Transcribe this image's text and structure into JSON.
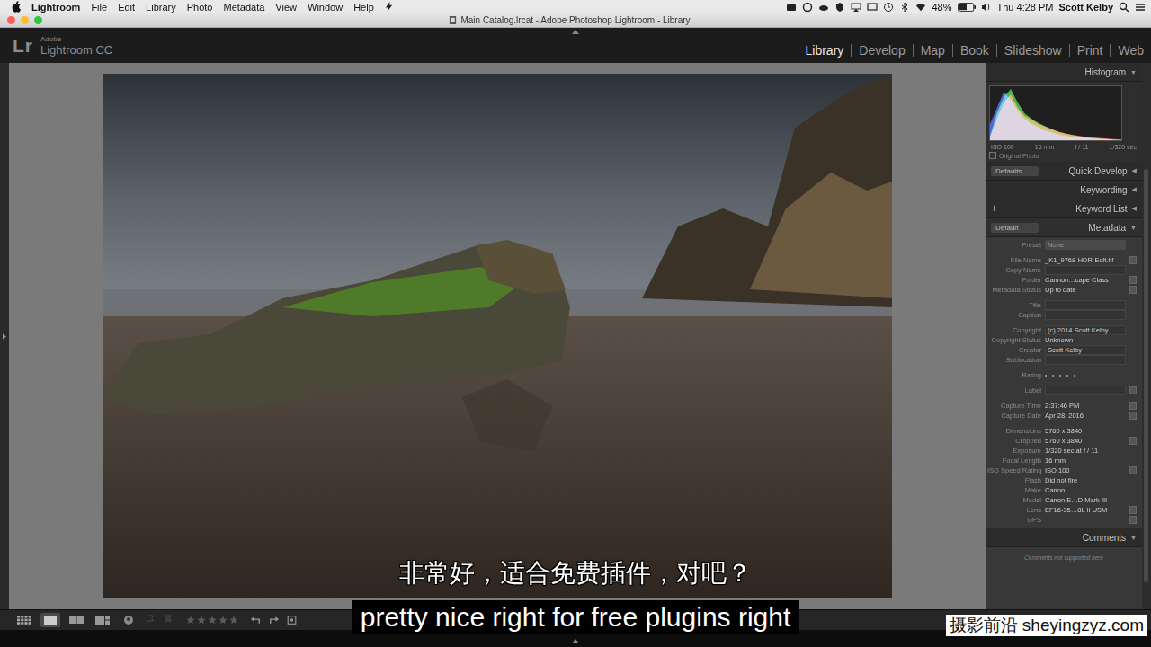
{
  "menubar": {
    "app": "Lightroom",
    "items": [
      "File",
      "Edit",
      "Library",
      "Photo",
      "Metadata",
      "View",
      "Window",
      "Help"
    ],
    "battery": "48%",
    "clock": "Thu 4:28 PM",
    "user": "Scott Kelby"
  },
  "window": {
    "title": "Main Catalog.lrcat - Adobe Photoshop Lightroom - Library"
  },
  "identity": {
    "logo": "Lr",
    "maker": "Adobe",
    "product": "Lightroom CC"
  },
  "modules": [
    {
      "label": "Library",
      "selected": true
    },
    {
      "label": "Develop",
      "selected": false
    },
    {
      "label": "Map",
      "selected": false
    },
    {
      "label": "Book",
      "selected": false
    },
    {
      "label": "Slideshow",
      "selected": false
    },
    {
      "label": "Print",
      "selected": false
    },
    {
      "label": "Web",
      "selected": false
    }
  ],
  "histogram": {
    "title": "Histogram",
    "toggle": "▼",
    "series": [
      {
        "color": "#d83a3a",
        "values": [
          5,
          40,
          70,
          85,
          60,
          45,
          38,
          30,
          25,
          20,
          16,
          12,
          10,
          8,
          6,
          5,
          4,
          3,
          2,
          1
        ]
      },
      {
        "color": "#3cb83c",
        "values": [
          8,
          50,
          80,
          95,
          70,
          50,
          40,
          32,
          26,
          20,
          15,
          12,
          9,
          7,
          5,
          4,
          3,
          2,
          1,
          1
        ]
      },
      {
        "color": "#3c5ce0",
        "values": [
          30,
          60,
          90,
          75,
          55,
          40,
          30,
          24,
          18,
          14,
          10,
          8,
          6,
          5,
          4,
          3,
          2,
          2,
          1,
          1
        ]
      }
    ],
    "info": [
      "ISO 100",
      "16 mm",
      "f / 11",
      "1/320 sec"
    ],
    "original_photo": {
      "label": "Original Photo",
      "checked": false
    }
  },
  "sections": [
    {
      "title": "Quick Develop",
      "toggle": "◀",
      "expanded": false,
      "kind": "preset",
      "preset": "Defaults"
    },
    {
      "title": "Keywording",
      "toggle": "◀",
      "expanded": false,
      "kind": "plain"
    },
    {
      "title": "Keyword List",
      "toggle": "◀",
      "expanded": false,
      "kind": "plus",
      "plus": "+"
    },
    {
      "title": "Metadata",
      "toggle": "▼",
      "expanded": true,
      "kind": "preset",
      "preset": "Default"
    }
  ],
  "metadata": {
    "preset_label": "Preset",
    "preset_value": "None",
    "groups": [
      [
        {
          "label": "File Name",
          "value": "_K1_9768-HDR-Edit.tif",
          "kind": "text",
          "button": true
        },
        {
          "label": "Copy Name",
          "value": "",
          "kind": "field",
          "button": false
        },
        {
          "label": "Folder",
          "value": "Cannon…cape Class",
          "kind": "text",
          "button": true
        },
        {
          "label": "Metadata Status",
          "value": "Up to date",
          "kind": "text",
          "button": true
        }
      ],
      [
        {
          "label": "Title",
          "value": "",
          "kind": "field",
          "button": false
        },
        {
          "label": "Caption",
          "value": "",
          "kind": "field",
          "button": false
        }
      ],
      [
        {
          "label": "Copyright",
          "value": "(c) 2014 Scott Kelby",
          "kind": "field",
          "button": false
        },
        {
          "label": "Copyright Status",
          "value": "Unknown",
          "kind": "text",
          "button": false
        },
        {
          "label": "Creator",
          "value": "Scott Kelby",
          "kind": "field",
          "button": false
        },
        {
          "label": "Sublocation",
          "value": "",
          "kind": "field",
          "button": false
        }
      ],
      [
        {
          "label": "Rating",
          "kind": "rating",
          "stars": 0,
          "button": false
        }
      ],
      [
        {
          "label": "Label",
          "value": "",
          "kind": "field",
          "button": true
        }
      ],
      [
        {
          "label": "Capture Time",
          "value": "2:37:46 PM",
          "kind": "text",
          "button": true
        },
        {
          "label": "Capture Date",
          "value": "Apr 28, 2016",
          "kind": "text",
          "button": true
        }
      ],
      [
        {
          "label": "Dimensions",
          "value": "5760 x 3840",
          "kind": "text",
          "button": false
        },
        {
          "label": "Cropped",
          "value": "5760 x 3840",
          "kind": "text",
          "button": true
        },
        {
          "label": "Exposure",
          "value": "1/320 sec at f / 11",
          "kind": "text",
          "button": false
        },
        {
          "label": "Focal Length",
          "value": "16 mm",
          "kind": "text",
          "button": false
        },
        {
          "label": "ISO Speed Rating",
          "value": "ISO 100",
          "kind": "text",
          "button": true
        },
        {
          "label": "Flash",
          "value": "Did not fire",
          "kind": "text",
          "button": false
        },
        {
          "label": "Make",
          "value": "Canon",
          "kind": "text",
          "button": false
        },
        {
          "label": "Model",
          "value": "Canon E…D Mark III",
          "kind": "text",
          "button": false
        },
        {
          "label": "Lens",
          "value": "EF16-35…8L II USM",
          "kind": "text",
          "button": true
        },
        {
          "label": "GPS",
          "value": "",
          "kind": "text",
          "button": true
        }
      ]
    ]
  },
  "comments": {
    "title": "Comments",
    "toggle": "▼",
    "note": "Comments not supported here"
  },
  "toolbar": {
    "view_modes": [
      {
        "kind": "grid",
        "selected": false
      },
      {
        "kind": "loupe",
        "selected": true
      },
      {
        "kind": "compare",
        "selected": false
      },
      {
        "kind": "survey",
        "selected": false
      },
      {
        "kind": "people",
        "selected": false
      }
    ],
    "stars": 0
  },
  "subtitles": {
    "zh": "非常好，适合免费插件，对吧？",
    "en": "pretty nice right for free plugins right"
  },
  "watermark": "摄影前沿 sheyingzyz.com"
}
